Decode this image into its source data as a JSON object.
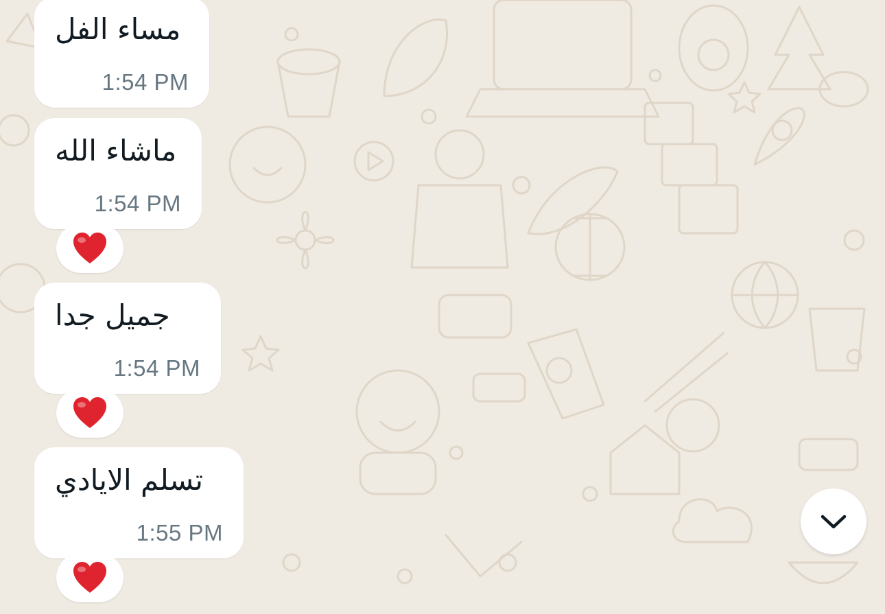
{
  "messages": [
    {
      "text": "مساء الفل",
      "time": "1:54 PM",
      "reaction": ""
    },
    {
      "text": "ماشاء الله",
      "time": "1:54 PM",
      "reaction": "heart"
    },
    {
      "text": "جميل جدا",
      "time": "1:54 PM",
      "reaction": "heart"
    },
    {
      "text": "تسلم الايادي",
      "time": "1:55 PM",
      "reaction": "heart"
    }
  ],
  "icons": {
    "reaction": "red-heart-icon",
    "scroll": "chevron-down-icon"
  },
  "colors": {
    "background": "#efeae2",
    "bubble": "#ffffff",
    "text": "#111b21",
    "time": "#667781",
    "heart": "#e0242f"
  }
}
